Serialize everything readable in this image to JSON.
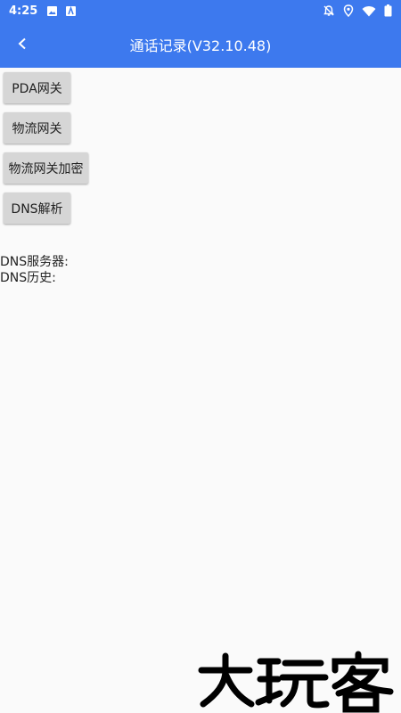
{
  "status_bar": {
    "time": "4:25",
    "left_icons": [
      "image-icon",
      "app-notification-icon"
    ],
    "right_icons": [
      "notifications-off-icon",
      "location-icon",
      "wifi-icon",
      "battery-icon"
    ]
  },
  "app_bar": {
    "back_icon": "chevron-left-icon",
    "title": "通话记录(V32.10.48)",
    "color": "#3d79ee"
  },
  "buttons": {
    "pda_gateway": "PDA网关",
    "logistics_gateway": "物流网关",
    "logistics_gateway_encrypt": "物流网关加密",
    "dns_resolve": "DNS解析"
  },
  "info": {
    "dns_server_label": "DNS服务器:",
    "dns_history_label": "DNS历史:"
  },
  "watermark": {
    "text": "大玩客"
  }
}
